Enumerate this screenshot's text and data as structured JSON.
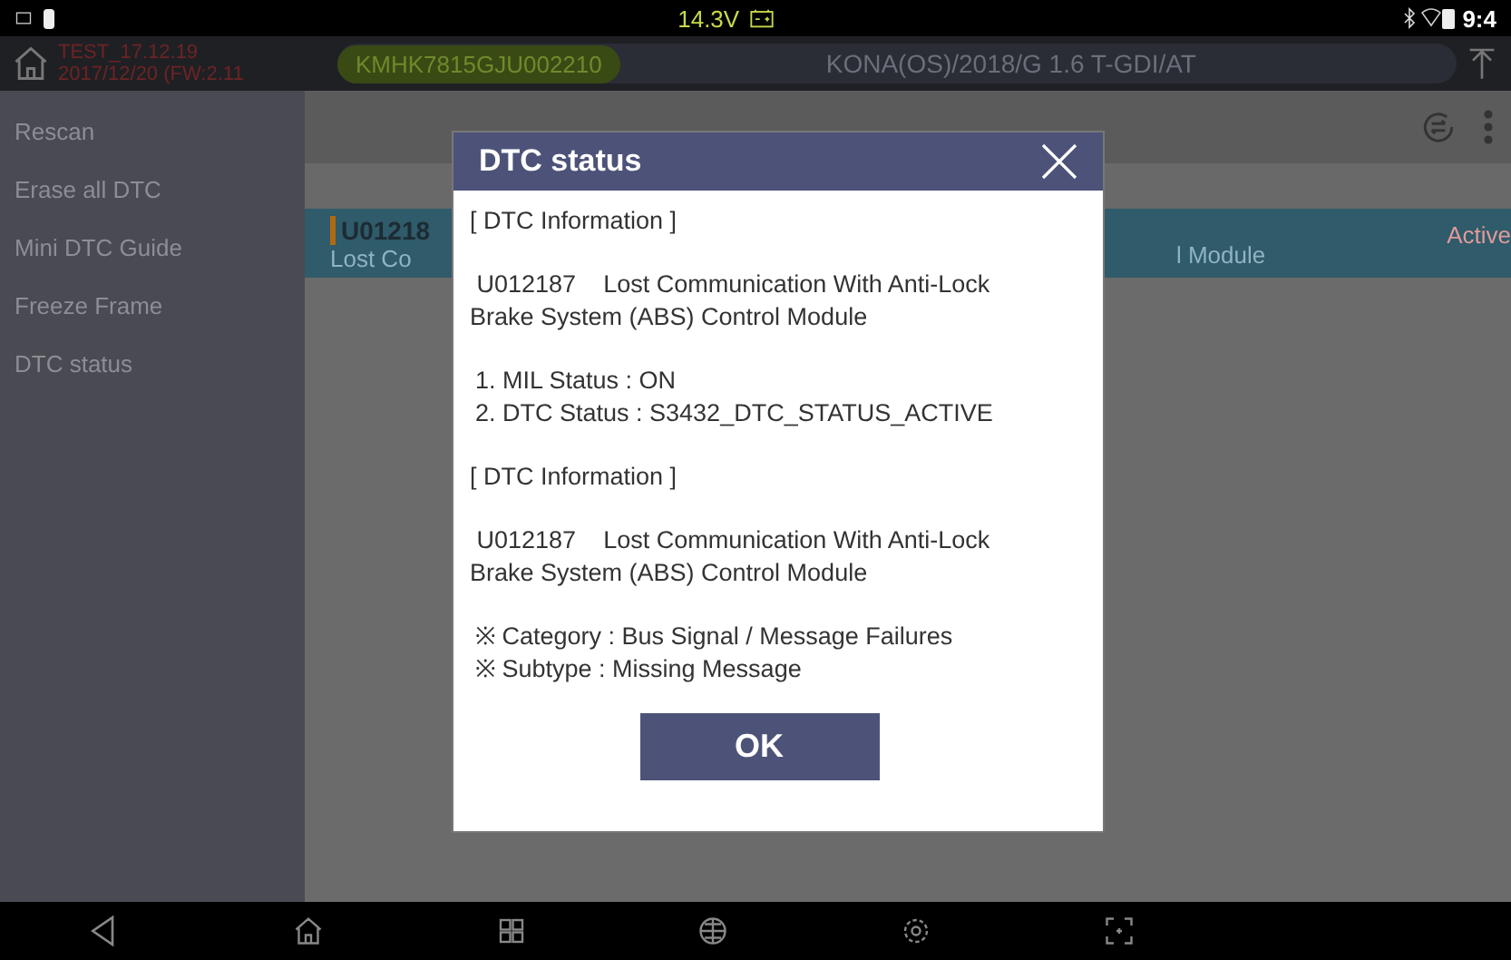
{
  "status_bar": {
    "voltage": "14.3V",
    "time": "9:4"
  },
  "header": {
    "test_name": "TEST_17.12.19",
    "test_date": "2017/12/20 (FW:2.11",
    "vin": "KMHK7815GJU002210",
    "vehicle": "KONA(OS)/2018/G 1.6 T-GDI/AT"
  },
  "sidebar": {
    "items": [
      {
        "label": "Rescan"
      },
      {
        "label": "Erase all DTC"
      },
      {
        "label": "Mini DTC Guide"
      },
      {
        "label": "Freeze Frame"
      },
      {
        "label": "DTC status"
      }
    ]
  },
  "dtc_row": {
    "code": "U01218",
    "description_start": "Lost Co",
    "description_end": "l Module",
    "status": "Active"
  },
  "dialog": {
    "title": "DTC status",
    "sections": [
      {
        "heading": "[ DTC Information ]",
        "code": "U012187",
        "description": "Lost Communication With Anti-Lock Brake System (ABS) Control Module",
        "lines": [
          "1. MIL Status : ON",
          "2. DTC Status : S3432_DTC_STATUS_ACTIVE"
        ]
      },
      {
        "heading": "[ DTC Information ]",
        "code": "U012187",
        "description": "Lost Communication With Anti-Lock Brake System (ABS) Control Module",
        "lines": [
          "※ Category : Bus Signal / Message Failures",
          "※ Subtype : Missing Message"
        ]
      }
    ],
    "button": "OK"
  }
}
